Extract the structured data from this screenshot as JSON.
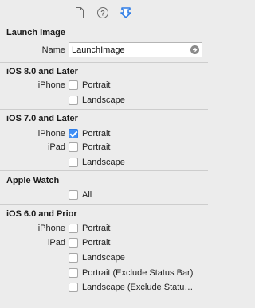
{
  "toolbar": {
    "icons": [
      "file-inspector-icon",
      "help-icon",
      "attributes-inspector-icon"
    ]
  },
  "launch_image": {
    "title": "Launch Image",
    "name_label": "Name",
    "name_value": "LaunchImage"
  },
  "ios8": {
    "title": "iOS 8.0 and Later",
    "iphone_label": "iPhone",
    "portrait": "Portrait",
    "landscape": "Landscape",
    "portrait_checked": false,
    "landscape_checked": false
  },
  "ios7": {
    "title": "iOS 7.0 and Later",
    "iphone_label": "iPhone",
    "iphone_portrait": "Portrait",
    "iphone_portrait_checked": true,
    "ipad_label": "iPad",
    "ipad_portrait": "Portrait",
    "ipad_landscape": "Landscape"
  },
  "watch": {
    "title": "Apple Watch",
    "all": "All"
  },
  "ios6": {
    "title": "iOS 6.0 and Prior",
    "iphone_label": "iPhone",
    "iphone_portrait": "Portrait",
    "ipad_label": "iPad",
    "ipad_portrait": "Portrait",
    "ipad_landscape": "Landscape",
    "ipad_portrait_exclude": "Portrait (Exclude Status Bar)",
    "ipad_landscape_exclude": "Landscape (Exclude Statu…"
  },
  "colors": {
    "accent": "#3f8ff6",
    "panel_bg": "#ececec"
  }
}
